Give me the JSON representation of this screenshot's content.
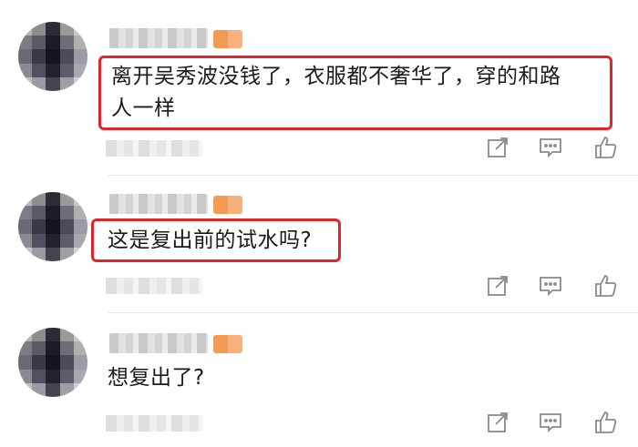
{
  "comments": [
    {
      "text_line1": "离开吴秀波没钱了，衣服都不奢华了，穿的和路",
      "text_line2": "人一样",
      "highlighted": true
    },
    {
      "text_line1": "这是复出前的试水吗?",
      "highlighted": true
    },
    {
      "text_line1": "想复出了?",
      "highlighted": false
    }
  ],
  "icons": {
    "share": "share-icon",
    "reply": "comment-icon",
    "like": "like-icon"
  },
  "colors": {
    "highlight": "#e0262b",
    "badge": "#f39a55",
    "icon": "#8a8a8a"
  }
}
